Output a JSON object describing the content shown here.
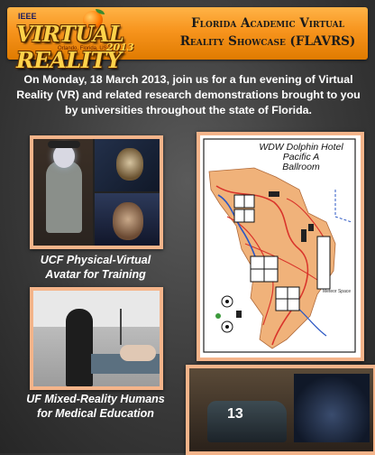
{
  "header": {
    "logo": {
      "org": "IEEE",
      "name": "VIRTUAL REALITY",
      "year": "2013",
      "location": "Orlando, Florida, USA"
    },
    "title_line1": "Florida Academic Virtual",
    "title_line2": "Reality Showcase (FLAVRS)"
  },
  "intro": "On Monday, 18 March 2013, join us for a fun evening of Virtual Reality (VR) and related research demonstrations brought to you by universities throughout the state of Florida.",
  "photos": [
    {
      "caption_line1": "UCF Physical-Virtual",
      "caption_line2": "Avatar for Training"
    },
    {
      "caption_line1": "UF Mixed-Reality Humans",
      "caption_line2": "for Medical Education"
    },
    {
      "car_number": "13"
    }
  ],
  "map": {
    "label_line1": "WDW Dolphin Hotel",
    "label_line2": "Pacific A",
    "label_line3": "Ballroom",
    "meteor_label": "Meteor Space"
  },
  "colors": {
    "header_orange": "#f7941d",
    "frame_peach": "#f4b48a",
    "map_floor": "#f0b27a",
    "path_red": "#d9342b",
    "water_blue": "#2b57c4"
  }
}
